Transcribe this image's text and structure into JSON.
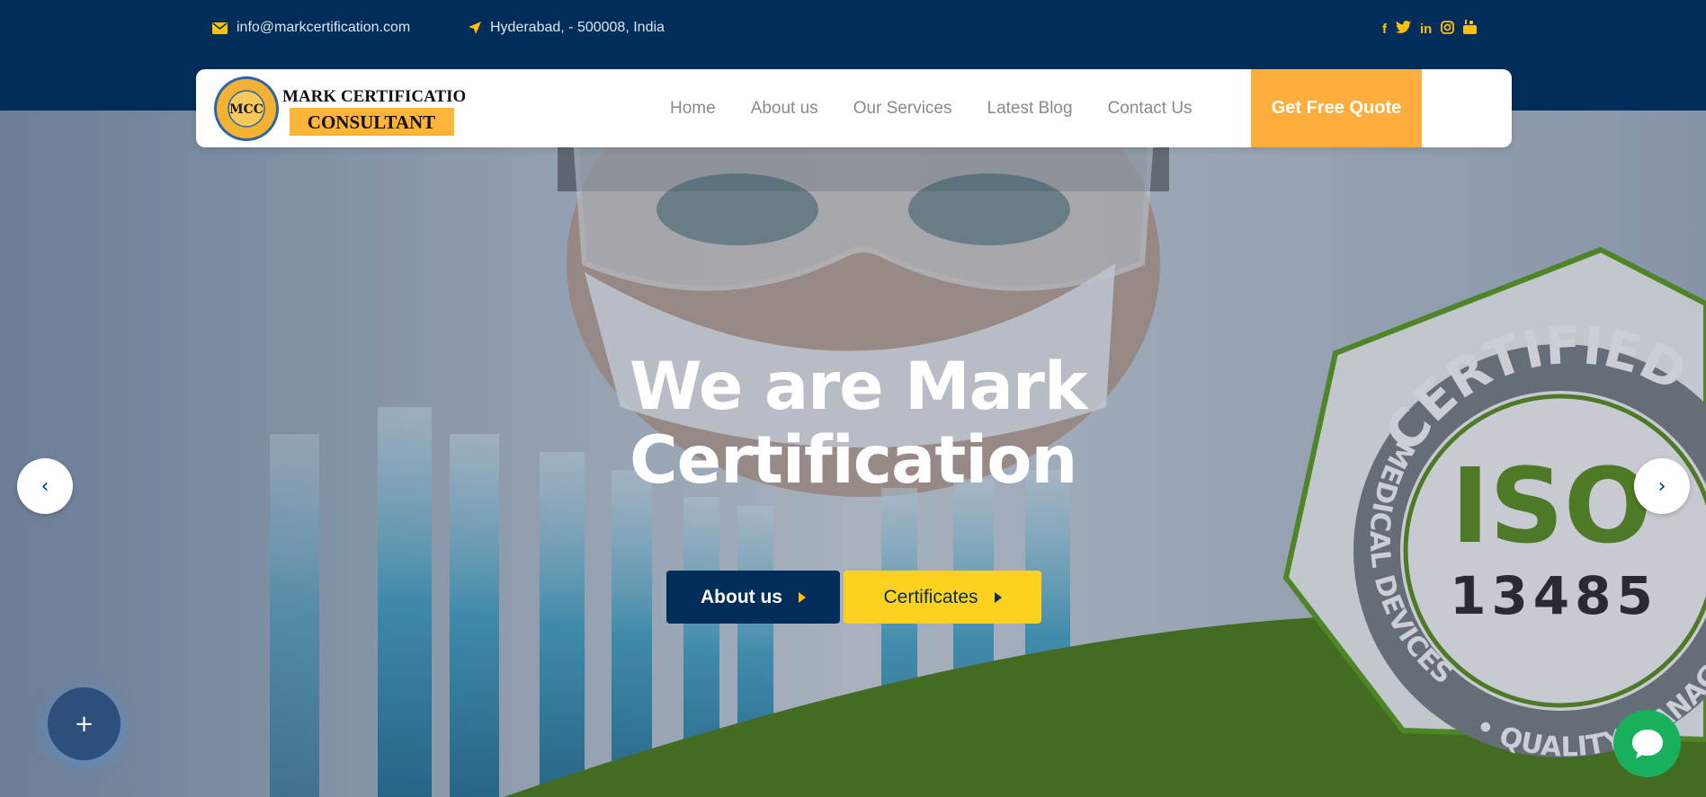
{
  "topbar": {
    "email": "info@markcertification.com",
    "location": "Hyderabad, - 500008, India",
    "socials": [
      "facebook-icon",
      "twitter-icon",
      "linkedin-icon",
      "instagram-icon",
      "youtube-icon"
    ]
  },
  "logo": {
    "line1": "MARK CERTIFICATION",
    "line2": "CONSULTANT",
    "badge": "MCC"
  },
  "nav": {
    "items": [
      "Home",
      "About us",
      "Our Services",
      "Latest Blog",
      "Contact Us"
    ],
    "cta": "Get Free Quote"
  },
  "hero": {
    "headline_line1": "We are Mark",
    "headline_line2": "Certification",
    "btn_about": "About us",
    "btn_certificates": "Certificates",
    "prev": "‹",
    "next": "›",
    "iso_badge": {
      "top": "CERTIFIED",
      "iso": "ISO",
      "number": "13485",
      "left": "MEDICAL DEVICES",
      "bottom": "QUALITY MANAGEMENT"
    }
  },
  "fab": {
    "label": "+"
  },
  "colors": {
    "navy": "#002d5a",
    "accent_yellow": "#fdd21f",
    "quote_orange": "#ffae3d",
    "green": "#4d7a1a",
    "chat_green": "#19b05c"
  }
}
